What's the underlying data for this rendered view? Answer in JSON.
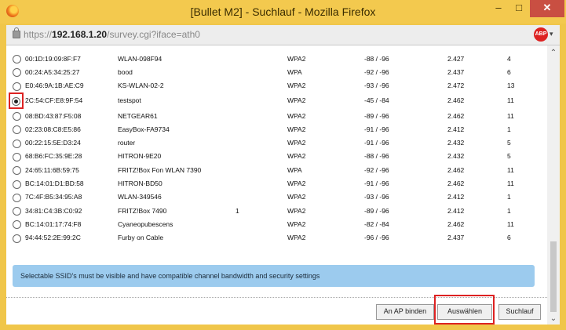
{
  "window": {
    "title": "[Bullet M2] - Suchlauf - Mozilla Firefox",
    "minimize": "–",
    "maximize": "□",
    "close": "✕"
  },
  "address": {
    "prefix": "https://",
    "host": "192.168.1.20",
    "path": "/survey.cgi?iface=ath0",
    "abp_label": "ABP"
  },
  "rows": [
    {
      "mac": "00:1D:19:09:8F:F7",
      "ssid": "WLAN-098F94",
      "extra": "",
      "enc": "WPA2",
      "signal": "-88 / -96",
      "freq": "2.427",
      "channel": "4",
      "selected": false
    },
    {
      "mac": "00:24:A5:34:25:27",
      "ssid": "bood",
      "extra": "",
      "enc": "WPA",
      "signal": "-92 / -96",
      "freq": "2.437",
      "channel": "6",
      "selected": false
    },
    {
      "mac": "E0:46:9A:1B:AE:C9",
      "ssid": "KS-WLAN-02-2",
      "extra": "",
      "enc": "WPA2",
      "signal": "-93 / -96",
      "freq": "2.472",
      "channel": "13",
      "selected": false
    },
    {
      "mac": "2C:54:CF:E8:9F:54",
      "ssid": "testspot",
      "extra": "",
      "enc": "WPA2",
      "signal": "-45 / -84",
      "freq": "2.462",
      "channel": "11",
      "selected": true
    },
    {
      "mac": "08:BD:43:87:F5:08",
      "ssid": "NETGEAR61",
      "extra": "",
      "enc": "WPA2",
      "signal": "-89 / -96",
      "freq": "2.462",
      "channel": "11",
      "selected": false
    },
    {
      "mac": "02:23:08:C8:E5:86",
      "ssid": "EasyBox-FA9734",
      "extra": "",
      "enc": "WPA2",
      "signal": "-91 / -96",
      "freq": "2.412",
      "channel": "1",
      "selected": false
    },
    {
      "mac": "00:22:15:5E:D3:24",
      "ssid": "router",
      "extra": "",
      "enc": "WPA2",
      "signal": "-91 / -96",
      "freq": "2.432",
      "channel": "5",
      "selected": false
    },
    {
      "mac": "68:B6:FC:35:9E:28",
      "ssid": "HITRON-9E20",
      "extra": "",
      "enc": "WPA2",
      "signal": "-88 / -96",
      "freq": "2.432",
      "channel": "5",
      "selected": false
    },
    {
      "mac": "24:65:11:6B:59:75",
      "ssid": "FRITZ!Box Fon WLAN 7390",
      "extra": "",
      "enc": "WPA",
      "signal": "-92 / -96",
      "freq": "2.462",
      "channel": "11",
      "selected": false
    },
    {
      "mac": "BC:14:01:D1:BD:58",
      "ssid": "HITRON-BD50",
      "extra": "",
      "enc": "WPA2",
      "signal": "-91 / -96",
      "freq": "2.462",
      "channel": "11",
      "selected": false
    },
    {
      "mac": "7C:4F:B5:34:95:A8",
      "ssid": "WLAN-349546",
      "extra": "",
      "enc": "WPA2",
      "signal": "-93 / -96",
      "freq": "2.412",
      "channel": "1",
      "selected": false
    },
    {
      "mac": "34:81:C4:3B:C0:92",
      "ssid": "FRITZ!Box 7490",
      "extra": "1",
      "enc": "WPA2",
      "signal": "-89 / -96",
      "freq": "2.412",
      "channel": "1",
      "selected": false
    },
    {
      "mac": "BC:14:01:17:74:F8",
      "ssid": "Cyaneopubescens",
      "extra": "",
      "enc": "WPA2",
      "signal": "-82 / -84",
      "freq": "2.462",
      "channel": "11",
      "selected": false
    },
    {
      "mac": "94:44:52:2E:99:2C",
      "ssid": "Furby on Cable",
      "extra": "",
      "enc": "WPA2",
      "signal": "-96 / -96",
      "freq": "2.437",
      "channel": "6",
      "selected": false
    }
  ],
  "info_text": "Selectable SSID's must be visible and have compatible channel bandwidth and security settings",
  "buttons": {
    "bind": "An AP binden",
    "select": "Auswählen",
    "scan": "Suchlauf"
  },
  "scrollbar": {
    "up": "⌃",
    "down": "⌄"
  }
}
